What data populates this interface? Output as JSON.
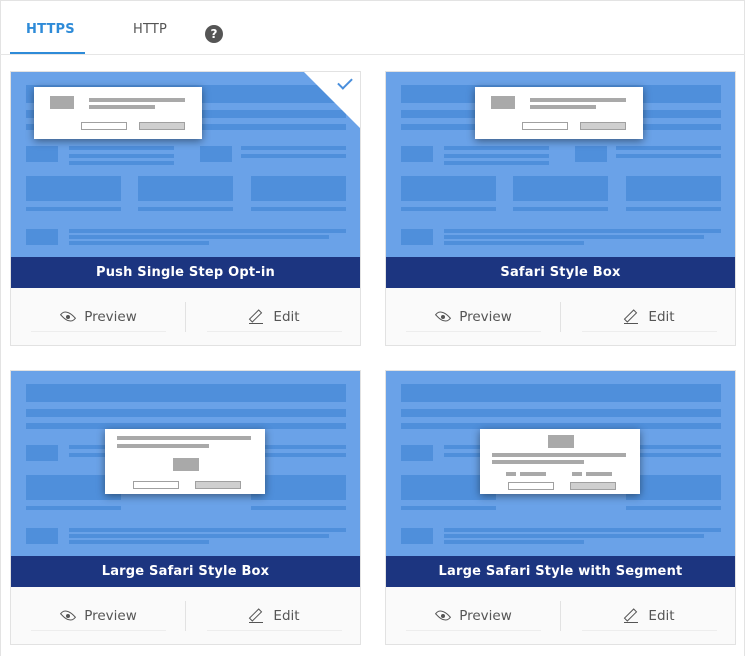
{
  "tabs": [
    {
      "label": "HTTPS",
      "active": true
    },
    {
      "label": "HTTP",
      "active": false
    }
  ],
  "help_label": "?",
  "colors": {
    "accent": "#2e8bd8",
    "title_bar": "#1c3580",
    "thumb_bg": "#6aa2e8"
  },
  "cards": [
    {
      "title": "Push Single Step Opt-in",
      "selected": true,
      "preview_label": "Preview",
      "edit_label": "Edit"
    },
    {
      "title": "Safari Style Box",
      "selected": false,
      "preview_label": "Preview",
      "edit_label": "Edit"
    },
    {
      "title": "Large Safari Style Box",
      "selected": false,
      "preview_label": "Preview",
      "edit_label": "Edit"
    },
    {
      "title": "Large Safari Style with Segment",
      "selected": false,
      "preview_label": "Preview",
      "edit_label": "Edit"
    }
  ],
  "icons": {
    "preview": "eye-icon",
    "edit": "pencil-icon",
    "selected": "checkmark-icon"
  }
}
